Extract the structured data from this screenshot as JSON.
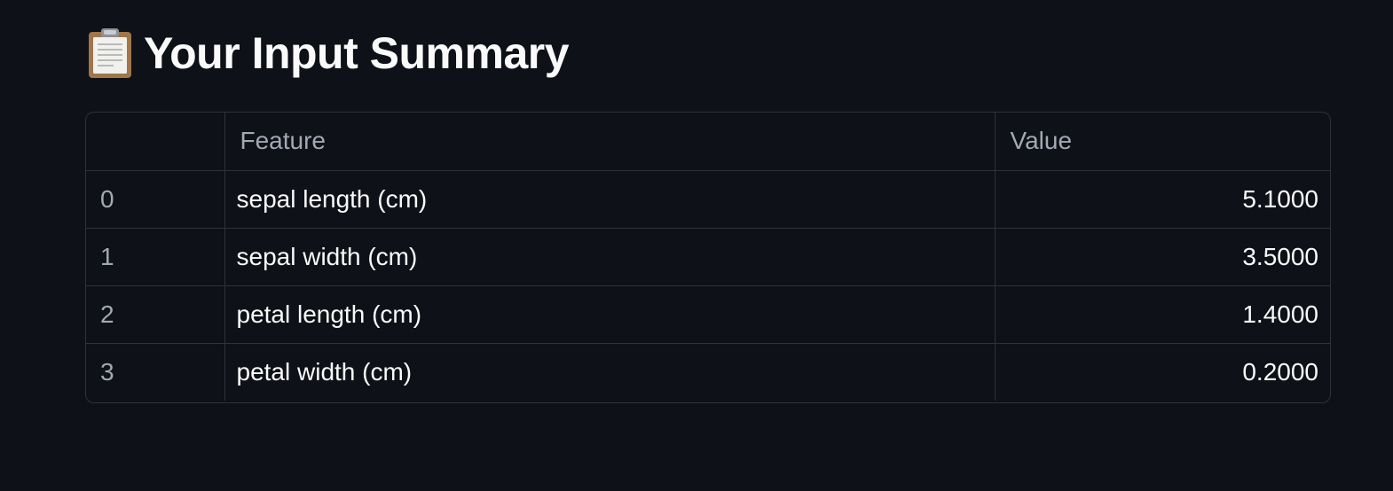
{
  "heading": {
    "icon": "clipboard-icon",
    "title": "Your Input Summary"
  },
  "table": {
    "columns": [
      "",
      "Feature",
      "Value"
    ],
    "rows": [
      {
        "index": "0",
        "feature": "sepal length (cm)",
        "value": "5.1000"
      },
      {
        "index": "1",
        "feature": "sepal width (cm)",
        "value": "3.5000"
      },
      {
        "index": "2",
        "feature": "petal length (cm)",
        "value": "1.4000"
      },
      {
        "index": "3",
        "feature": "petal width (cm)",
        "value": "0.2000"
      }
    ]
  },
  "colors": {
    "background": "#0e1117",
    "text": "#fafafa",
    "muted_text": "#a3a8b4",
    "border": "#2f323a"
  }
}
